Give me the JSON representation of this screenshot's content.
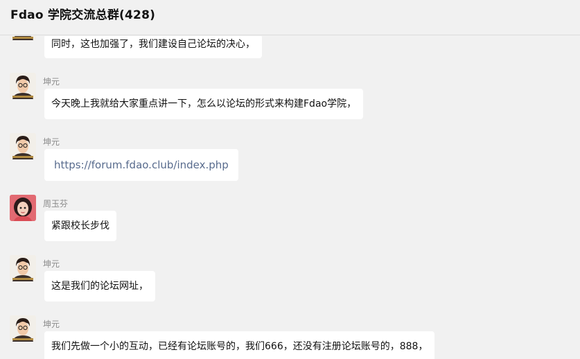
{
  "header": {
    "title": "Fdao 学院交流总群(428)"
  },
  "messages": [
    {
      "sender": "",
      "text": "同时，这也加强了，我们建设自己论坛的决心，",
      "avatar": "man-glasses-avatar"
    },
    {
      "sender": "坤元",
      "text": "今天晚上我就给大家重点讲一下，怎么以论坛的形式来构建Fdao学院，",
      "avatar": "man-glasses-avatar"
    },
    {
      "sender": "坤元",
      "text": "https://forum.fdao.club/index.php",
      "avatar": "man-glasses-avatar",
      "is_link": true
    },
    {
      "sender": "周玉芬",
      "text": "紧跟校长步伐",
      "avatar": "woman-avatar"
    },
    {
      "sender": "坤元",
      "text": "这是我们的论坛网址，",
      "avatar": "man-glasses-avatar"
    },
    {
      "sender": "坤元",
      "text": "我们先做一个小的互动，已经有论坛账号的，我们666，还没有注册论坛账号的，888，",
      "avatar": "man-glasses-avatar"
    }
  ],
  "colors": {
    "background": "#f1f1f1",
    "bubble": "#ffffff",
    "link": "#586b8d",
    "sender": "#8a8a8a"
  }
}
